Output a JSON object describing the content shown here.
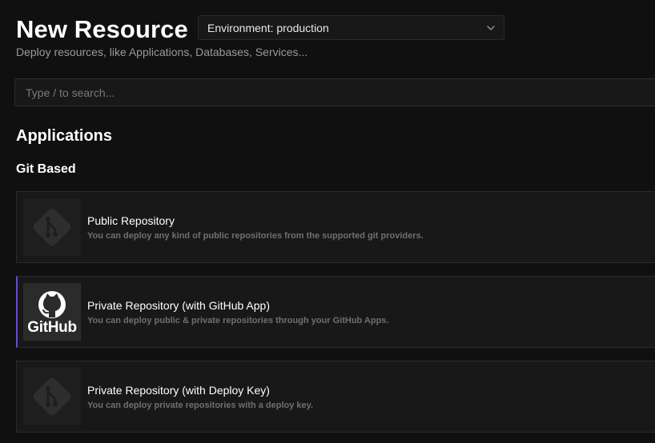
{
  "header": {
    "title": "New Resource",
    "subtitle": "Deploy resources, like Applications, Databases, Services..."
  },
  "environment_select": {
    "value": "Environment: production",
    "icon": "chevron-down-icon"
  },
  "search": {
    "placeholder": "Type / to search...",
    "value": ""
  },
  "sections": {
    "applications_heading": "Applications",
    "git_based_heading": "Git Based"
  },
  "cards": [
    {
      "title": "Public Repository",
      "description": "You can deploy any kind of public repositories from the supported git providers.",
      "icon": "git-icon"
    },
    {
      "title": "Private Repository (with GitHub App)",
      "description": "You can deploy public & private repositories through your GitHub Apps.",
      "icon": "github-icon",
      "logo_text": "GitHub",
      "active": true
    },
    {
      "title": "Private Repository (with Deploy Key)",
      "description": "You can deploy private repositories with a deploy key.",
      "icon": "git-icon"
    }
  ],
  "colors": {
    "background": "#101010",
    "card_background": "#181818",
    "active_accent": "#6b46e0",
    "muted_text": "#6f6f6f"
  }
}
